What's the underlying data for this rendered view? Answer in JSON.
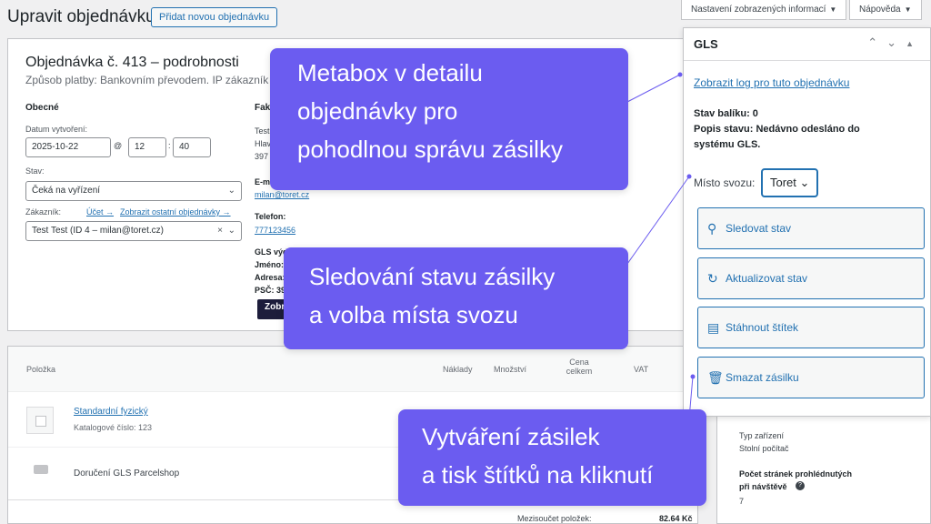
{
  "header": {
    "title": "Upravit objednávku",
    "add_order_button": "Přidat novou objednávku",
    "screen_options": "Nastavení zobrazených informací",
    "help": "Nápověda"
  },
  "order": {
    "title": "Objednávka č. 413 – podrobnosti",
    "subtitle": "Způsob platby: Bankovním převodem. IP zákazník",
    "general_heading": "Obecné",
    "created_label": "Datum vytvoření:",
    "created_date": "2025-10-22",
    "hour": "12",
    "minute": "40",
    "status_label": "Stav:",
    "status_value": "Čeká na vyřízení",
    "customer_label": "Zákazník:",
    "customer_links": [
      "Účet →",
      "Zobrazit ostatní objednávky →"
    ],
    "customer_value": "Test Test (ID 4 – milan@toret.cz)",
    "billing_heading": "Fak",
    "billing_lines": [
      "Test",
      "Hlav",
      "397"
    ],
    "email_label": "E-m",
    "email_value": "milan@toret.cz",
    "phone_label": "Telefon:",
    "phone_value": "777123456",
    "gls_lines": [
      "GLS výd",
      "Jméno:",
      "Adresa:",
      "PSČ: 39"
    ],
    "dark_button": "Zobr"
  },
  "items": {
    "columns": [
      "Položka",
      "Náklady",
      "Množství",
      "Cena celkem",
      "VAT"
    ],
    "product_name": "Standardní fyzický",
    "product_sku": "Katalogové číslo: 123",
    "shipping_name": "Doručení GLS Parcelshop",
    "subtotal_label": "Mezisoučet položek:",
    "subtotal_value": "82.64 Kč"
  },
  "side_info": {
    "device_type_label": "Typ zařízení",
    "device_type_value": "Stolní počítač",
    "pages_label_1": "Počet stránek prohlédnutých",
    "pages_label_2": "při návštěvě",
    "pages_value": "7"
  },
  "gls": {
    "title": "GLS",
    "log_link": "Zobrazit log pro tuto objednávku",
    "package_status": "Stav balíku: 0",
    "status_desc_1": "Popis stavu: Nedávno odesláno do",
    "status_desc_2": "systému GLS.",
    "pickup_label": "Místo svozu:",
    "pickup_value": "Toret",
    "actions": [
      {
        "label": "Sledovat stav",
        "icon": "magnifier-icon"
      },
      {
        "label": "Aktualizovat stav",
        "icon": "refresh-icon"
      },
      {
        "label": "Stáhnout štítek",
        "icon": "pdf-icon"
      },
      {
        "label": "Smazat zásilku",
        "icon": "trash-icon"
      }
    ]
  },
  "callouts": {
    "metabox": [
      "Metabox v detailu",
      "objednávky pro",
      "pohodlnou správu zásilky"
    ],
    "tracking": [
      "Sledování stavu zásilky",
      "a volba místa svozu"
    ],
    "creation": [
      "Vytváření zásilek",
      "a tisk štítků na kliknutí"
    ]
  },
  "colors": {
    "callout_bg": "#6b5cf0",
    "link": "#2271b1"
  }
}
